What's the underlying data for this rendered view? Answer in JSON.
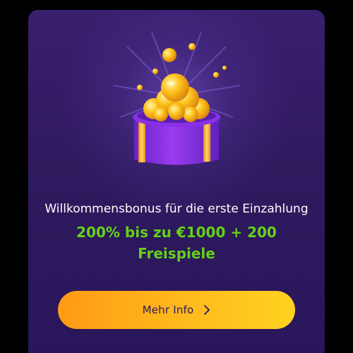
{
  "promo": {
    "subtitle": "Willkommensbonus für die erste Einzahlung",
    "headline": "200% bis zu €1000 + 200 Freispiele",
    "cta_label": "Mehr Info"
  },
  "icons": {
    "hero": "gift-box-with-gold-coins-icon",
    "cta": "chevron-right-icon"
  },
  "colors": {
    "page_background": "#000000",
    "card_background": "#2f1a5e",
    "headline": "#64d219",
    "cta_gradient_start": "#ff9a14",
    "cta_gradient_end": "#ffd321",
    "cta_text": "#2d1b5b"
  }
}
